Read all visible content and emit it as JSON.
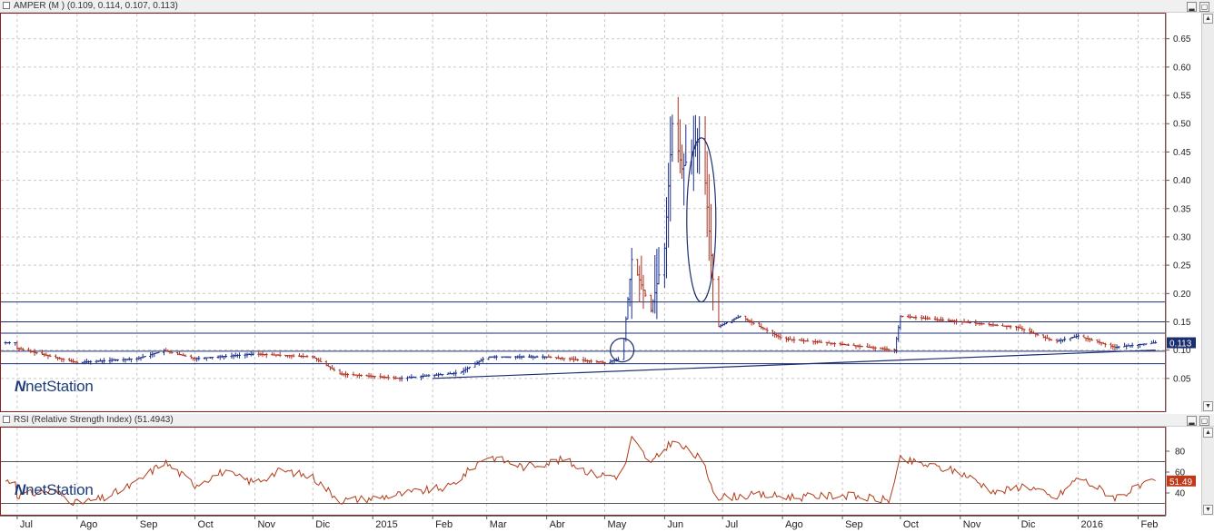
{
  "main_panel": {
    "title": "AMPER (M ) (0.109, 0.114, 0.107, 0.113)",
    "last_price_tag": "0.113",
    "logo": "netStation"
  },
  "rsi_panel": {
    "title": "RSI (Relative Strength Index) (51.4943)",
    "last_value_tag": "51.49",
    "logo": "netStation"
  },
  "x_axis": {
    "labels": [
      "Jul",
      "Ago",
      "Sep",
      "Oct",
      "Nov",
      "Dic",
      "2015",
      "Feb",
      "Mar",
      "Abr",
      "May",
      "Jun",
      "Jul",
      "Ago",
      "Sep",
      "Oct",
      "Nov",
      "Dic",
      "2016",
      "Feb"
    ]
  },
  "colors": {
    "up_bar": "#1a2f8a",
    "down_bar": "#b03020",
    "rsi_line": "#b23b17",
    "level_lines": "#1b2e6e",
    "price_tag_bg": "#1b2e6e",
    "rsi_tag_bg": "#c0391b",
    "grid": "#c8c8c8"
  },
  "chart_data": [
    {
      "type": "ohlc",
      "title": "AMPER (M ) (0.109, 0.114, 0.107, 0.113)",
      "last": {
        "open": 0.109,
        "high": 0.114,
        "low": 0.107,
        "close": 0.113
      },
      "y_ticks": [
        0.05,
        0.1,
        0.15,
        0.2,
        0.25,
        0.3,
        0.35,
        0.4,
        0.45,
        0.5,
        0.55,
        0.6,
        0.65
      ],
      "ylim": [
        0.0,
        0.68
      ],
      "x_labels": [
        "Jul",
        "Ago",
        "Sep",
        "Oct",
        "Nov",
        "Dic",
        "2015",
        "Feb",
        "Mar",
        "Abr",
        "May",
        "Jun",
        "Jul",
        "Ago",
        "Sep",
        "Oct",
        "Nov",
        "Dic",
        "2016",
        "Feb"
      ],
      "grid": true,
      "horizontal_levels": [
        0.076,
        0.098,
        0.13,
        0.15,
        0.185
      ],
      "trendline": {
        "start": {
          "x": "Feb 2015",
          "y": 0.05
        },
        "end": {
          "x": "Feb 2016",
          "y": 0.1
        }
      },
      "approx_close_path": [
        {
          "x": "2014-07-01",
          "y": 0.103
        },
        {
          "x": "2014-08-01",
          "y": 0.078
        },
        {
          "x": "2014-09-01",
          "y": 0.085
        },
        {
          "x": "2014-09-15",
          "y": 0.099
        },
        {
          "x": "2014-10-01",
          "y": 0.085
        },
        {
          "x": "2014-11-01",
          "y": 0.093
        },
        {
          "x": "2014-12-01",
          "y": 0.088
        },
        {
          "x": "2014-12-15",
          "y": 0.058
        },
        {
          "x": "2015-01-15",
          "y": 0.05
        },
        {
          "x": "2015-02-15",
          "y": 0.06
        },
        {
          "x": "2015-03-01",
          "y": 0.088
        },
        {
          "x": "2015-04-01",
          "y": 0.088
        },
        {
          "x": "2015-05-01",
          "y": 0.078
        },
        {
          "x": "2015-05-10",
          "y": 0.085
        },
        {
          "x": "2015-05-15",
          "y": 0.26
        },
        {
          "x": "2015-05-25",
          "y": 0.17
        },
        {
          "x": "2015-06-01",
          "y": 0.28
        },
        {
          "x": "2015-06-05",
          "y": 0.5
        },
        {
          "x": "2015-06-10",
          "y": 0.42
        },
        {
          "x": "2015-06-20",
          "y": 0.48
        },
        {
          "x": "2015-06-28",
          "y": 0.14
        },
        {
          "x": "2015-07-10",
          "y": 0.16
        },
        {
          "x": "2015-08-01",
          "y": 0.12
        },
        {
          "x": "2015-09-01",
          "y": 0.11
        },
        {
          "x": "2015-09-28",
          "y": 0.1
        },
        {
          "x": "2015-10-01",
          "y": 0.16
        },
        {
          "x": "2015-11-01",
          "y": 0.15
        },
        {
          "x": "2015-12-01",
          "y": 0.14
        },
        {
          "x": "2015-12-20",
          "y": 0.115
        },
        {
          "x": "2016-01-01",
          "y": 0.125
        },
        {
          "x": "2016-01-20",
          "y": 0.105
        },
        {
          "x": "2016-02-10",
          "y": 0.113
        }
      ]
    },
    {
      "type": "line",
      "title": "RSI (Relative Strength Index) (51.4943)",
      "last": 51.4943,
      "y_ticks": [
        40,
        60,
        80
      ],
      "ylim": [
        20,
        100
      ],
      "horizontal_levels": [
        30,
        70
      ],
      "series": [
        {
          "name": "RSI (Relative Strength Index)",
          "points": [
            {
              "x": "2014-07-01",
              "y": 38
            },
            {
              "x": "2014-07-20",
              "y": 42
            },
            {
              "x": "2014-08-01",
              "y": 30
            },
            {
              "x": "2014-08-15",
              "y": 35
            },
            {
              "x": "2014-09-01",
              "y": 50
            },
            {
              "x": "2014-09-15",
              "y": 70
            },
            {
              "x": "2014-10-01",
              "y": 48
            },
            {
              "x": "2014-10-15",
              "y": 60
            },
            {
              "x": "2014-11-01",
              "y": 50
            },
            {
              "x": "2014-11-15",
              "y": 62
            },
            {
              "x": "2014-12-01",
              "y": 55
            },
            {
              "x": "2014-12-15",
              "y": 33
            },
            {
              "x": "2015-01-01",
              "y": 35
            },
            {
              "x": "2015-01-20",
              "y": 40
            },
            {
              "x": "2015-02-10",
              "y": 46
            },
            {
              "x": "2015-03-01",
              "y": 76
            },
            {
              "x": "2015-03-20",
              "y": 65
            },
            {
              "x": "2015-04-10",
              "y": 72
            },
            {
              "x": "2015-04-25",
              "y": 58
            },
            {
              "x": "2015-05-10",
              "y": 56
            },
            {
              "x": "2015-05-15",
              "y": 92
            },
            {
              "x": "2015-05-25",
              "y": 68
            },
            {
              "x": "2015-06-05",
              "y": 90
            },
            {
              "x": "2015-06-20",
              "y": 72
            },
            {
              "x": "2015-06-28",
              "y": 36
            },
            {
              "x": "2015-07-20",
              "y": 38
            },
            {
              "x": "2015-08-10",
              "y": 36
            },
            {
              "x": "2015-09-01",
              "y": 38
            },
            {
              "x": "2015-09-25",
              "y": 33
            },
            {
              "x": "2015-10-01",
              "y": 72
            },
            {
              "x": "2015-11-01",
              "y": 60
            },
            {
              "x": "2015-11-20",
              "y": 40
            },
            {
              "x": "2015-12-05",
              "y": 48
            },
            {
              "x": "2015-12-20",
              "y": 34
            },
            {
              "x": "2016-01-01",
              "y": 55
            },
            {
              "x": "2016-01-20",
              "y": 36
            },
            {
              "x": "2016-02-10",
              "y": 51.49
            }
          ]
        }
      ]
    }
  ]
}
